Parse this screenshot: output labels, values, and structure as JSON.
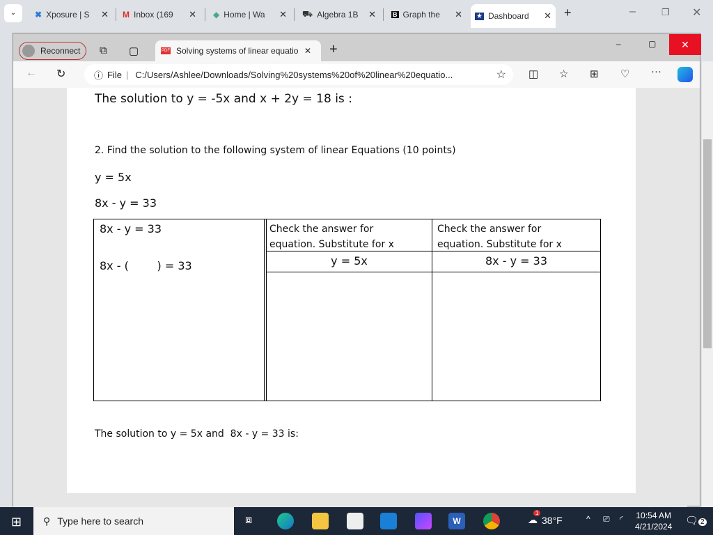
{
  "chrome_tabs": [
    {
      "label": "Xposure | S",
      "icon": "xposure-icon"
    },
    {
      "label": "Inbox (169",
      "icon": "gmail-icon"
    },
    {
      "label": "Home | Wa",
      "icon": "home-icon"
    },
    {
      "label": "Algebra 1B",
      "icon": "algebra-icon"
    },
    {
      "label": "Graph the",
      "icon": "b-icon"
    },
    {
      "label": "Dashboard",
      "icon": "shield-star-icon",
      "active": true
    }
  ],
  "inner": {
    "reconnect": "Reconnect",
    "tab_title": "Solving systems of linear equatio",
    "file_label": "File",
    "url": "C:/Users/Ashlee/Downloads/Solving%20systems%20of%20linear%20equatio...",
    "close_color": "#e81123"
  },
  "doc": {
    "prev_solution": "The solution to y = -5x and x + 2y = 18 is :",
    "q2": "2. Find the solution to the following system of linear Equations (10 points)",
    "eq1": "y = 5x",
    "eq2": "8x - y = 33",
    "table": {
      "col1_line1": "8x - y = 33",
      "col1_line2": "8x - (        ) = 33",
      "col2_header": "Check the answer for equation. Substitute for x",
      "col3_header": "Check the answer for equation. Substitute for x",
      "col2_eq": "y = 5x",
      "col3_eq": "8x - y = 33"
    },
    "solution": "The solution to y = 5x and  8x - y = 33 is:"
  },
  "taskbar": {
    "search_placeholder": "Type here to search",
    "weather": "38°F",
    "weather_badge": "1",
    "time": "10:54 AM",
    "date": "4/21/2024",
    "notifications": "2"
  }
}
